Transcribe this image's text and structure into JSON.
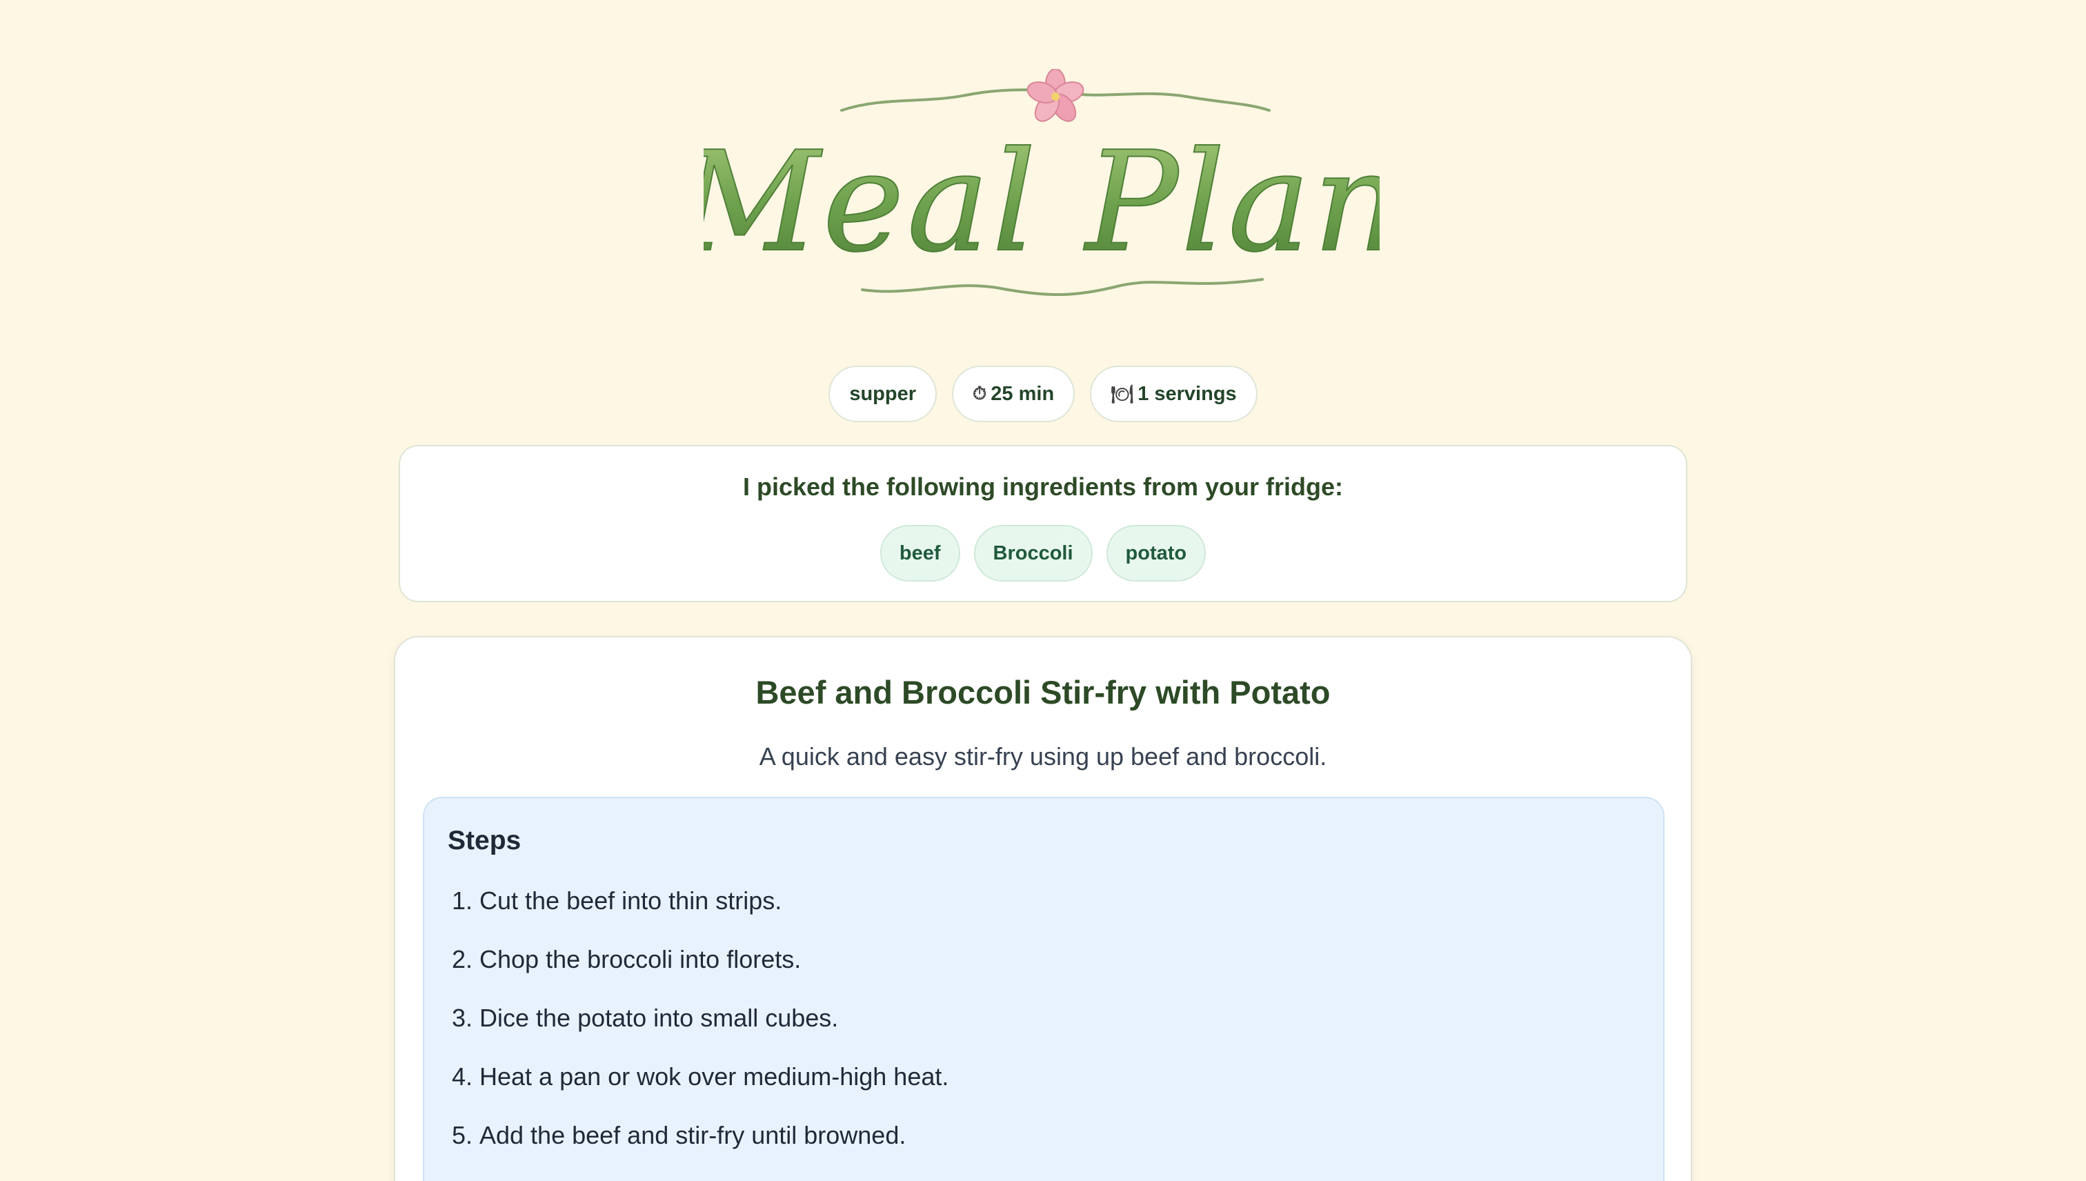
{
  "logo": {
    "text": "Meal Plan"
  },
  "meta": {
    "meal_type": "supper",
    "time_icon": "stopwatch-icon",
    "time": "25 min",
    "servings_icon": "plate-icon",
    "servings": "1 servings"
  },
  "ingredients": {
    "heading": "I picked the following ingredients from your fridge:",
    "items": [
      "beef",
      "Broccoli",
      "potato"
    ]
  },
  "recipe": {
    "title": "Beef and Broccoli Stir-fry with Potato",
    "description": "A quick and easy stir-fry using up beef and broccoli.",
    "steps_heading": "Steps",
    "steps": [
      {
        "num": "1.",
        "text": "Cut the beef into thin strips."
      },
      {
        "num": "2.",
        "text": "Chop the broccoli into florets."
      },
      {
        "num": "3.",
        "text": "Dice the potato into small cubes."
      },
      {
        "num": "4.",
        "text": "Heat a pan or wok over medium-high heat."
      },
      {
        "num": "5.",
        "text": "Add the beef and stir-fry until browned."
      }
    ]
  },
  "colors": {
    "background": "#fdf7e4",
    "title_green": "#2d4a26",
    "chip_bg": "#e8f7ee",
    "steps_bg": "#e8f2fd"
  }
}
